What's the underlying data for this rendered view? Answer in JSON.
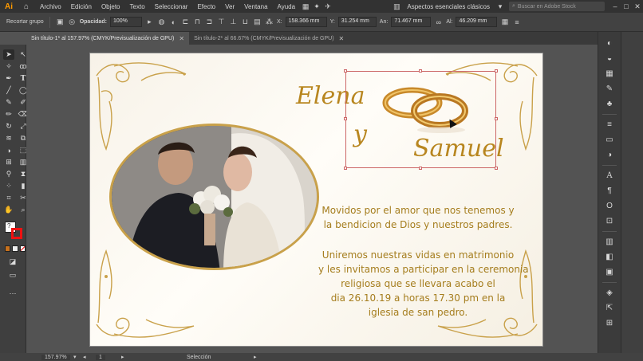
{
  "app": {
    "logo": "Ai",
    "menu": [
      "Archivo",
      "Edición",
      "Objeto",
      "Texto",
      "Seleccionar",
      "Efecto",
      "Ver",
      "Ventana",
      "Ayuda"
    ],
    "workspace": "Aspectos esenciales clásicos",
    "search_placeholder": "Buscar en Adobe Stock"
  },
  "control": {
    "context": "Recortar grupo",
    "opacity_label": "Opacidad:",
    "opacity_value": "100%",
    "x_label": "X:",
    "x_value": "158.366 mm",
    "y_label": "Y:",
    "y_value": "31.254 mm",
    "w_label": "An:",
    "w_value": "71.467 mm",
    "h_label": "Al:",
    "h_value": "46.209 mm"
  },
  "tabs": [
    {
      "label": "Sin título-1* al 157.97% (CMYK/Previsualización de GPU)"
    },
    {
      "label": "Sin título-2* al 66.67% (CMYK/Previsualización de GPU)"
    }
  ],
  "artwork": {
    "name_bride": "Elena",
    "conjunction": "y",
    "name_groom": "Samuel",
    "lines": [
      "Movidos por el amor que nos tenemos y",
      "la bendicion de Dios y nuestros padres.",
      "Uniremos nuestras vidas en matrimonio",
      "y les invitamos a participar en la ceremonia",
      "religiosa que se llevara acabo el",
      "dia 26.10.19 a horas 17.30 pm en la",
      "iglesia de san pedro."
    ],
    "colors": {
      "gold": "#b8861f",
      "text_gold": "#a57d1d",
      "paper": "#fbf7ee"
    }
  },
  "status": {
    "zoom": "157.97%",
    "page": "1",
    "mode": "Selección"
  },
  "tools_icons": [
    "selection-icon",
    "direct-selection-icon",
    "pen-icon",
    "curvature-icon",
    "text-icon",
    "line-icon",
    "rectangle-icon",
    "brush-icon",
    "pencil-icon",
    "eraser-icon",
    "rotate-icon",
    "scale-icon",
    "warp-icon",
    "free-transform-icon",
    "shape-builder-icon",
    "mesh-icon",
    "gradient-icon",
    "eyedropper-icon",
    "blend-icon",
    "symbol-sprayer-icon",
    "graph-icon",
    "artboard-icon",
    "slice-icon",
    "hand-icon",
    "zoom-icon"
  ]
}
